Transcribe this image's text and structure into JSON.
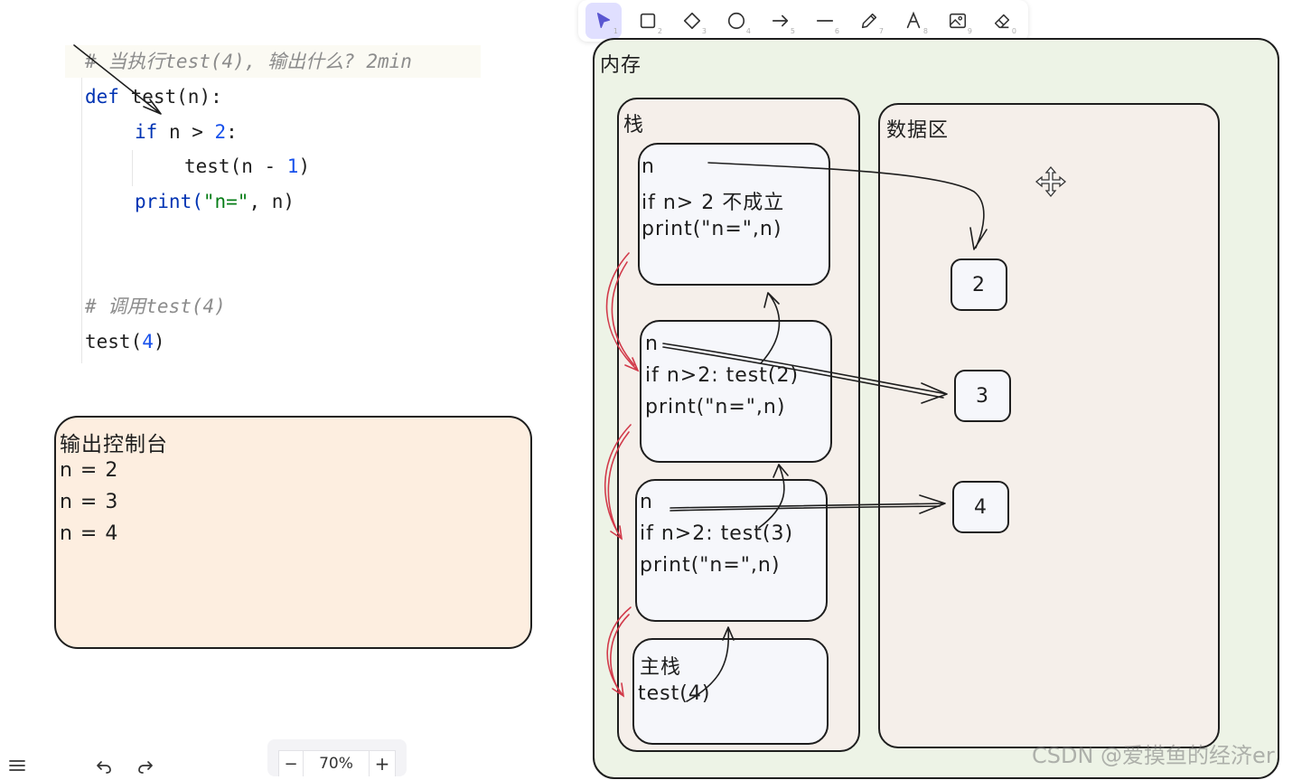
{
  "toolbar": {
    "tools": [
      {
        "name": "selection",
        "key": "1"
      },
      {
        "name": "rectangle",
        "key": "2"
      },
      {
        "name": "diamond",
        "key": "3"
      },
      {
        "name": "ellipse",
        "key": "4"
      },
      {
        "name": "arrow",
        "key": "5"
      },
      {
        "name": "line",
        "key": "6"
      },
      {
        "name": "draw",
        "key": "7"
      },
      {
        "name": "text",
        "key": "8"
      },
      {
        "name": "image",
        "key": "9"
      },
      {
        "name": "eraser",
        "key": "0"
      }
    ]
  },
  "code": {
    "comment1": "# 当执行test(4), 输出什么? 2min",
    "line_def_kw": "def",
    "line_def_rest": " test(n):",
    "line_if_kw": "if",
    "line_if_rest": " n > ",
    "line_if_num": "2",
    "line_if_colon": ":",
    "line_call_a": "test(n - ",
    "line_call_num": "1",
    "line_call_b": ")",
    "line_print_a": "print(",
    "line_print_str": "\"n=\"",
    "line_print_b": ", n)",
    "comment2": "# 调用test(4)",
    "line_main_a": "test(",
    "line_main_num": "4",
    "line_main_b": ")"
  },
  "console": {
    "title": "输出控制台",
    "lines": [
      "n = 2",
      "n = 3",
      "n = 4"
    ]
  },
  "memory": {
    "title": "内存",
    "stack_title": "栈",
    "data_title": "数据区",
    "frames": [
      {
        "l1": "n",
        "l2": "if n> 2 不成立",
        "l3": "print(\"n=\",n)"
      },
      {
        "l1": "n",
        "l2": "if n>2: test(2)",
        "l3": "print(\"n=\",n)"
      },
      {
        "l1": "n",
        "l2": "if n>2: test(3)",
        "l3": "print(\"n=\",n)"
      },
      {
        "l1": "主栈",
        "l2": "test(4)"
      }
    ],
    "values": [
      "2",
      "3",
      "4"
    ]
  },
  "bottom": {
    "zoom": "70%",
    "zoom_out": "−",
    "zoom_in": "+"
  },
  "watermark": "CSDN @爱摸鱼的经济er",
  "colors": {
    "memory_bg": "#edf3e6",
    "panel_bg": "#f5efea",
    "frame_bg": "#f6f7fb",
    "console_bg": "#fdeee0",
    "red_arrow": "#d23a4a",
    "toolbar_active": "#e0dfff"
  }
}
